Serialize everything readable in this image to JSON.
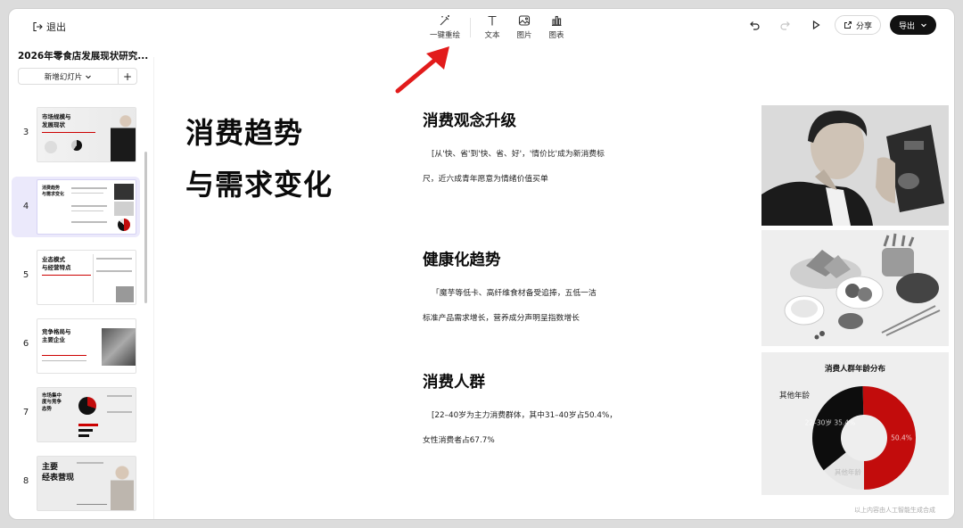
{
  "topbar": {
    "exit_label": "退出",
    "tools": [
      {
        "label": "一键重绘",
        "icon": "magic-wand-icon"
      },
      {
        "label": "文本",
        "icon": "text-icon"
      },
      {
        "label": "图片",
        "icon": "image-icon"
      },
      {
        "label": "图表",
        "icon": "chart-icon"
      }
    ],
    "share_label": "分享",
    "export_label": "导出"
  },
  "sidebar": {
    "doc_title": "2026年零食店发展现状研究...",
    "new_slide_label": "新增幻灯片",
    "slides": [
      {
        "number": "3",
        "title_line1": "市场规模与",
        "title_line2": "发展现状"
      },
      {
        "number": "4",
        "title_line1": "消费趋势",
        "title_line2": "与需求变化"
      },
      {
        "number": "5",
        "title_line1": "业态模式",
        "title_line2": "与经营特点"
      },
      {
        "number": "6",
        "title_line1": "竞争格局与",
        "title_line2": "主要企业"
      },
      {
        "number": "7",
        "title_line1": "市场集中",
        "title_line2": "度与竞争",
        "title_line3": "态势"
      },
      {
        "number": "8",
        "title_line1": "主要",
        "title_line2": "经表营现"
      }
    ]
  },
  "slide": {
    "title_line1": "消费趋势",
    "title_line2": "与需求变化",
    "sections": [
      {
        "heading": "消费观念升级",
        "line1": "[从'快、省'到'快、省、好'，'情价比'成为新消费标",
        "line2": "尺，近六成青年愿意为情绪价值买单"
      },
      {
        "heading": "健康化趋势",
        "line1": "「魔芋等低卡、高纤维食材备受追捧，五低一洁",
        "line2": "标准产品需求增长，营养成分声明呈指数增长"
      },
      {
        "heading": "消费人群",
        "line1": "[22–40岁为主力消费群体，其中31–40岁占50.4%，",
        "line2": "女性消费者占67.7%"
      }
    ],
    "footnote": "以上内容由人工智能生成合成"
  },
  "chart_data": {
    "type": "pie",
    "title": "消费人群年龄分布",
    "slices": [
      {
        "name": "31–40岁",
        "value": 50.4,
        "label": "50.4%",
        "color": "#c20c0c"
      },
      {
        "name": "22–30岁",
        "value": 35.4,
        "label": "22–30岁 35.4%",
        "color": "#0d0d0d"
      },
      {
        "name": "其他年龄",
        "value": 14.2,
        "label": "其他年龄",
        "color": "#e6e6e6"
      }
    ],
    "outside_label": "其他年龄"
  }
}
